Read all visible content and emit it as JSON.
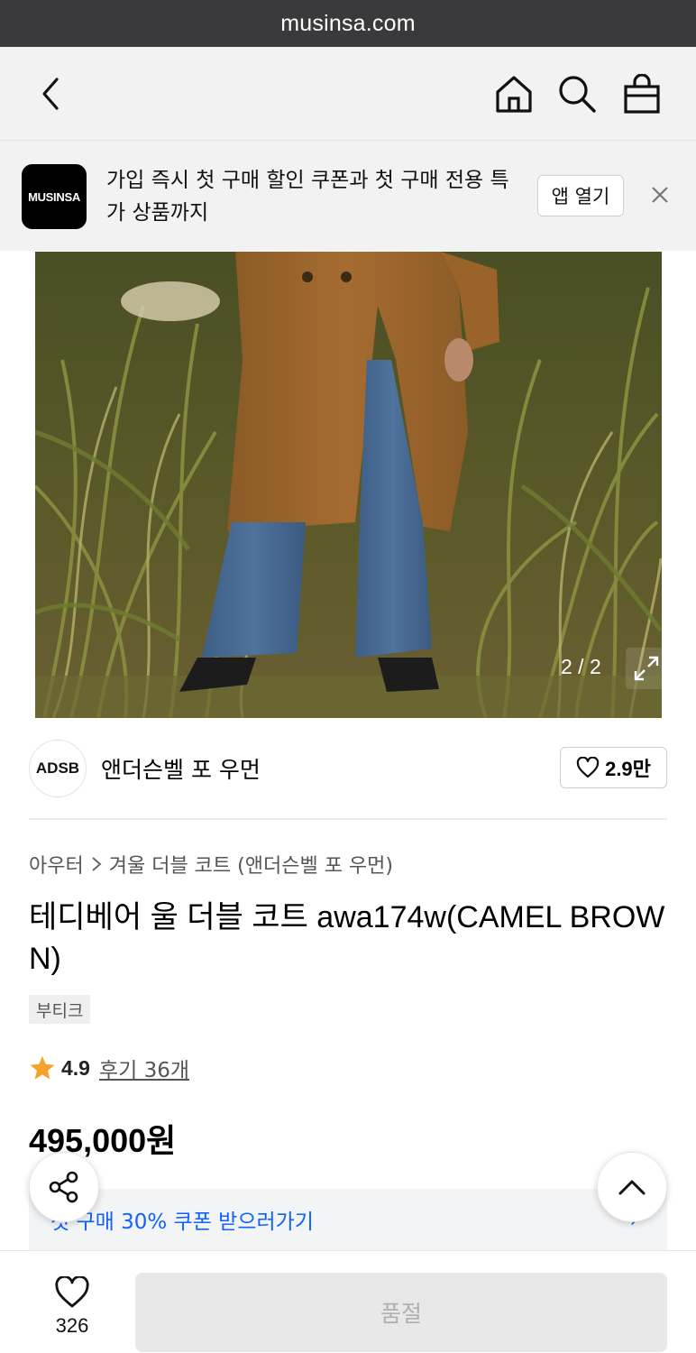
{
  "browser": {
    "url": "musinsa.com"
  },
  "header": {
    "icons": [
      "back-chevron-icon",
      "home-icon",
      "search-icon",
      "shopping-bag-icon"
    ]
  },
  "banner": {
    "logo_text": "MUSINSA",
    "message": "가입 즉시 첫 구매 할인 쿠폰과 첫 구매 전용 특가 상품까지",
    "open_app_label": "앱 열기"
  },
  "gallery": {
    "page_indicator": "2 / 2",
    "icons": [
      "expand-icon"
    ]
  },
  "brand": {
    "logo_text": "ADSB",
    "name": "앤더슨벨 포 우먼",
    "likes": "2.9만"
  },
  "breadcrumb": {
    "category": "아우터",
    "subcategory": "겨울 더블 코트 (앤더슨벨 포 우먼)"
  },
  "product": {
    "title": "테디베어 울 더블 코트 awa174w(CAMEL BROWN)",
    "tag": "부티크",
    "rating": "4.9",
    "reviews": "후기 36개",
    "price": "495,000원"
  },
  "coupon": {
    "text": "첫 구매 30% 쿠폰 받으러가기",
    "chevron": "›"
  },
  "bottom_bar": {
    "wish_count": "326",
    "buy_label": "품절"
  },
  "colors": {
    "accent_blue": "#0f62fe",
    "star": "#f7a12a",
    "url_bar": "#3a3a3c"
  }
}
